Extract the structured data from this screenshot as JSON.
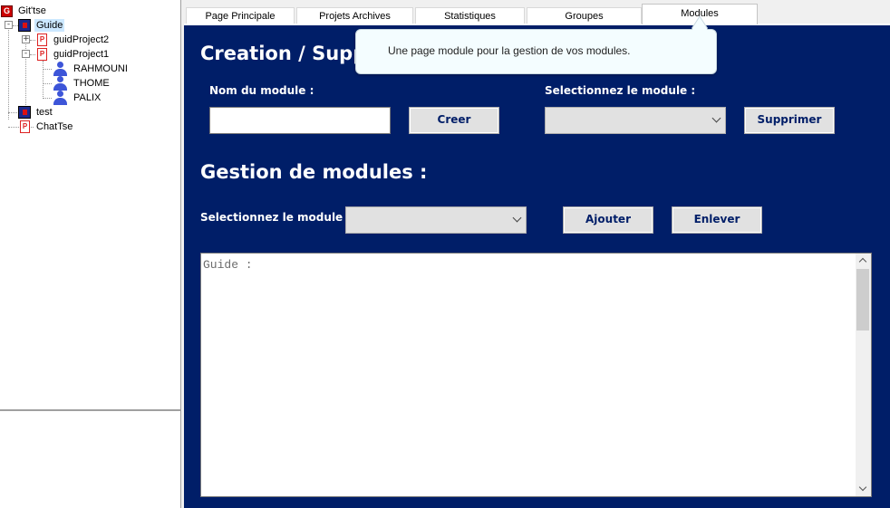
{
  "tree": {
    "root": {
      "label": "Git'tse",
      "icon": "app-icon",
      "badge": "G"
    },
    "nodes": [
      {
        "label": "Guide",
        "icon": "group-icon",
        "expander": "-",
        "selected": true
      },
      {
        "label": "guidProject2",
        "icon": "project-icon",
        "expander": "+",
        "badge": "P"
      },
      {
        "label": "guidProject1",
        "icon": "project-icon",
        "expander": "-",
        "badge": "P"
      },
      {
        "label": "RAHMOUNI",
        "icon": "user-icon"
      },
      {
        "label": "THOME",
        "icon": "user-icon"
      },
      {
        "label": "PALIX",
        "icon": "user-icon"
      },
      {
        "label": "test",
        "icon": "group-icon"
      },
      {
        "label": "ChatTse",
        "icon": "project-icon",
        "badge": "P"
      }
    ]
  },
  "tabs": [
    {
      "label": "Page Principale",
      "active": false
    },
    {
      "label": "Projets Archives",
      "active": false
    },
    {
      "label": "Statistiques",
      "active": false
    },
    {
      "label": "Groupes",
      "active": false
    },
    {
      "label": "Modules",
      "active": true
    }
  ],
  "main": {
    "create_heading": "Creation / Suppr",
    "module_name_label": "Nom du module :",
    "module_name_value": "",
    "create_button": "Creer",
    "select_module_label": "Selectionnez le module :",
    "delete_combo_value": "",
    "delete_button": "Supprimer",
    "manage_heading": "Gestion de modules :",
    "manage_select_label": "Selectionnez le module :",
    "manage_combo_value": "",
    "add_button": "Ajouter",
    "remove_button": "Enlever",
    "guide_text": "Guide :"
  },
  "tooltip": {
    "text": "Une page module pour la gestion de vos modules."
  },
  "colors": {
    "main_bg": "#001e68",
    "button_text": "#001e68",
    "tooltip_bg": "#f4fdff"
  }
}
